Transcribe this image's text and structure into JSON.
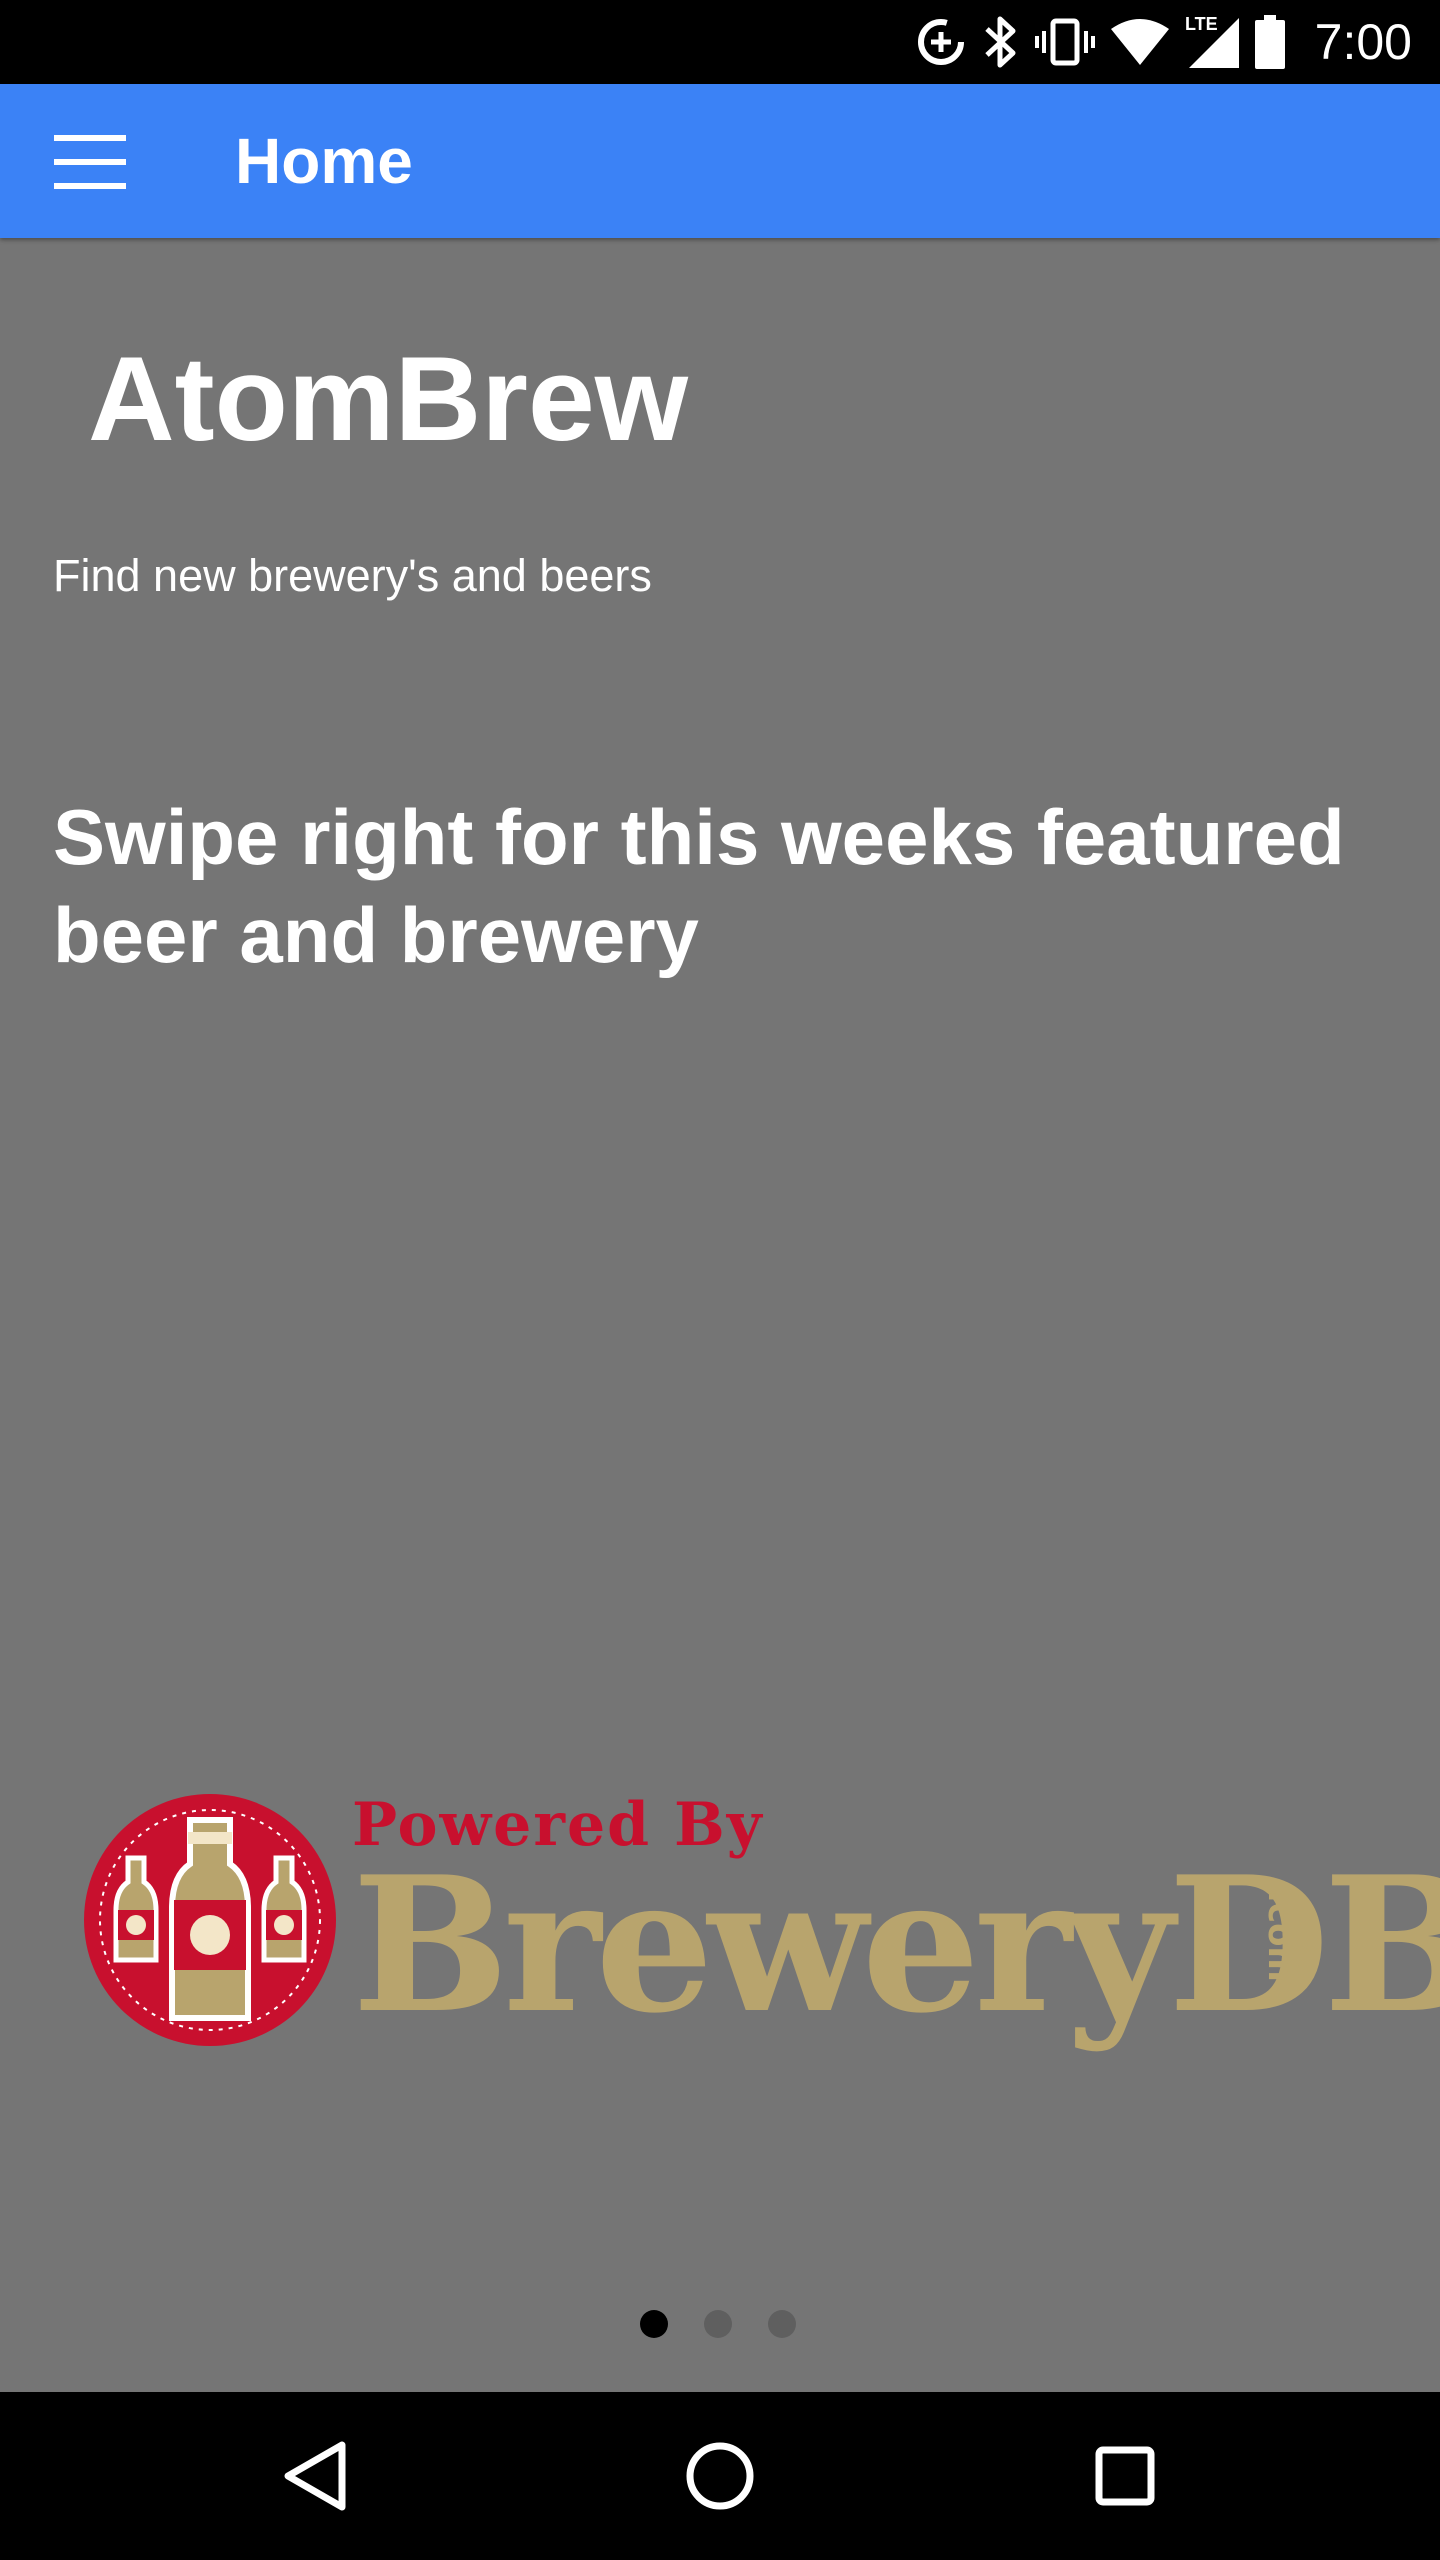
{
  "status_bar": {
    "time": "7:00",
    "network_label": "LTE",
    "icons": [
      "data-saver-icon",
      "bluetooth-icon",
      "vibrate-icon",
      "wifi-icon",
      "cell-signal-icon",
      "battery-icon"
    ]
  },
  "app_bar": {
    "menu_icon": "hamburger-menu-icon",
    "title": "Home",
    "background": "#3b82f6"
  },
  "main": {
    "background": "#757575",
    "app_name": "AtomBrew",
    "tagline": "Find new brewery's and beers",
    "swipe_hint": "Swipe right for this weeks featured beer and brewery"
  },
  "logo": {
    "powered_by": "Powered By",
    "brand": "BreweryDB",
    "tld": ".com",
    "red": "#c8102e",
    "gold": "#b8a46d"
  },
  "pager": {
    "total": 3,
    "active_index": 0
  },
  "nav_bar": {
    "buttons": [
      "back-icon",
      "home-icon",
      "recents-icon"
    ]
  }
}
